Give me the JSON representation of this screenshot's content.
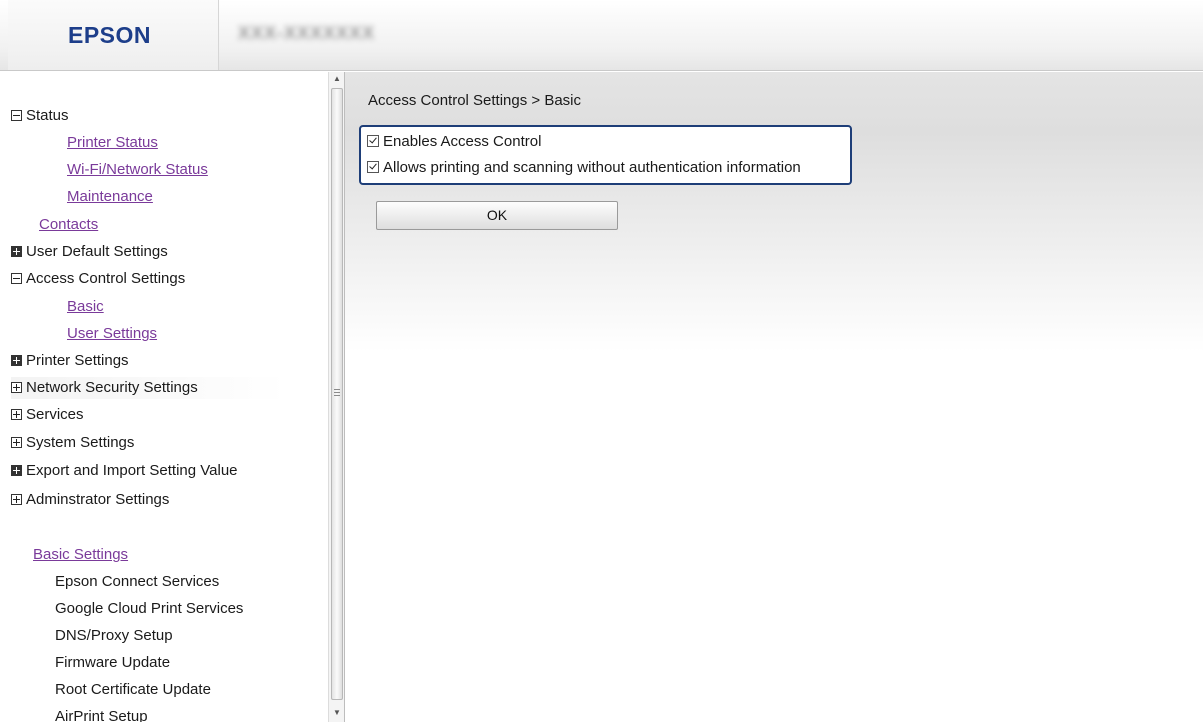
{
  "header": {
    "logo_text": "EPSON",
    "model_text": "XXX-XXXXXXX"
  },
  "sidebar": {
    "nav": [
      {
        "label": "Status",
        "toggle": "minus"
      },
      {
        "label": "Printer Status",
        "link": true
      },
      {
        "label": "Wi-Fi/Network Status",
        "link": true
      },
      {
        "label": "Maintenance",
        "link": true
      },
      {
        "label": "Contacts",
        "link": true
      },
      {
        "label": "User Default Settings",
        "toggle": "plus"
      },
      {
        "label": "Access Control Settings",
        "toggle": "minus"
      },
      {
        "label": "Basic",
        "link": true
      },
      {
        "label": "User Settings",
        "link": true
      },
      {
        "label": "Printer Settings",
        "toggle": "plus"
      },
      {
        "label": "Network Security Settings",
        "toggle": "plus"
      },
      {
        "label": "Services",
        "toggle": "plus"
      },
      {
        "label": "System Settings",
        "toggle": "plus"
      },
      {
        "label": "Export and Import Setting Value",
        "toggle": "plus"
      },
      {
        "label": "Adminstrator Settings",
        "toggle": "plus"
      }
    ],
    "basic_settings": {
      "title": "Basic Settings",
      "items": [
        "Epson Connect Services",
        "Google Cloud Print Services",
        "DNS/Proxy Setup",
        "Firmware Update",
        "Root Certificate Update",
        "AirPrint Setup"
      ]
    }
  },
  "main": {
    "breadcrumb": "Access Control Settings > Basic",
    "options": [
      {
        "label": "Enables Access Control",
        "checked": true
      },
      {
        "label": "Allows printing and scanning without authentication information",
        "checked": true
      }
    ],
    "ok_label": "OK"
  },
  "colors": {
    "logo": "#1d3e8a",
    "link": "#7a3a9a",
    "options_border": "#1e3e78"
  }
}
